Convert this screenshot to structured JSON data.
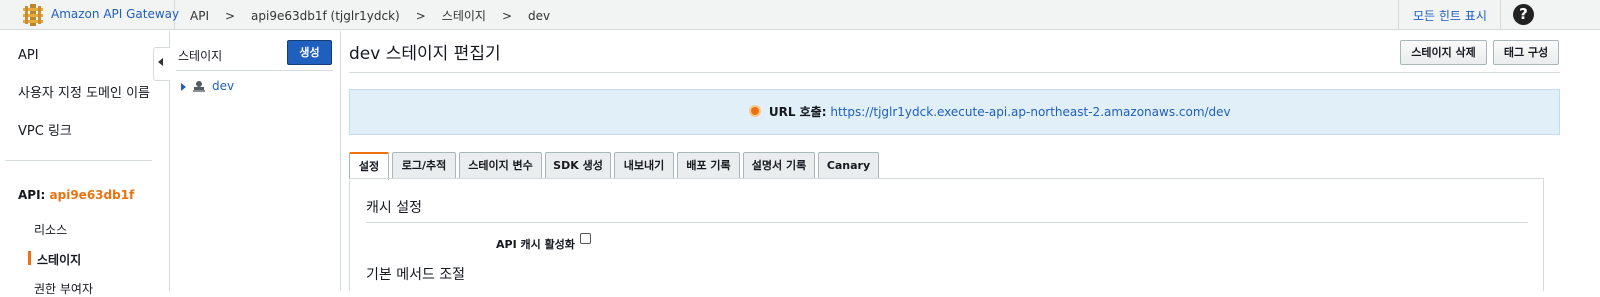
{
  "topbar": {
    "brand": "Amazon API Gateway",
    "breadcrumbs": [
      "API",
      "api9e63db1f (tjglr1ydck)",
      "스테이지",
      "dev"
    ],
    "breadcrumb_sep": ">",
    "hints_label": "모든 힌트 표시",
    "help_label": "?"
  },
  "sidebar": {
    "items": [
      "API",
      "사용자 지정 도메인 이름",
      "VPC 링크"
    ],
    "api_prefix": "API: ",
    "api_name": "api9e63db1f",
    "sub_items": [
      "리소스",
      "스테이지",
      "권한 부여자"
    ]
  },
  "stage_panel": {
    "label": "스테이지",
    "create_label": "생성",
    "tree_item": "dev"
  },
  "main": {
    "title": "dev 스테이지 편집기",
    "delete_stage_label": "스테이지 삭제",
    "tag_config_label": "태그 구성",
    "url_label": "URL 호출:",
    "url": "https://tjglr1ydck.execute-api.ap-northeast-2.amazonaws.com/dev",
    "tabs": [
      "설정",
      "로그/추적",
      "스테이지 변수",
      "SDK 생성",
      "내보내기",
      "배포 기록",
      "설명서 기록",
      "Canary"
    ],
    "active_tab": "설정",
    "cache_section_title": "캐시 설정",
    "cache_enable_label": "API 캐시 활성화",
    "cache_enabled": false,
    "throttle_section_title": "기본 메서드 조절"
  },
  "colors": {
    "accent": "#ec7211",
    "link": "#1f5fbd",
    "primary_button": "#1f5fbd",
    "info_box": "#e1eff8"
  }
}
